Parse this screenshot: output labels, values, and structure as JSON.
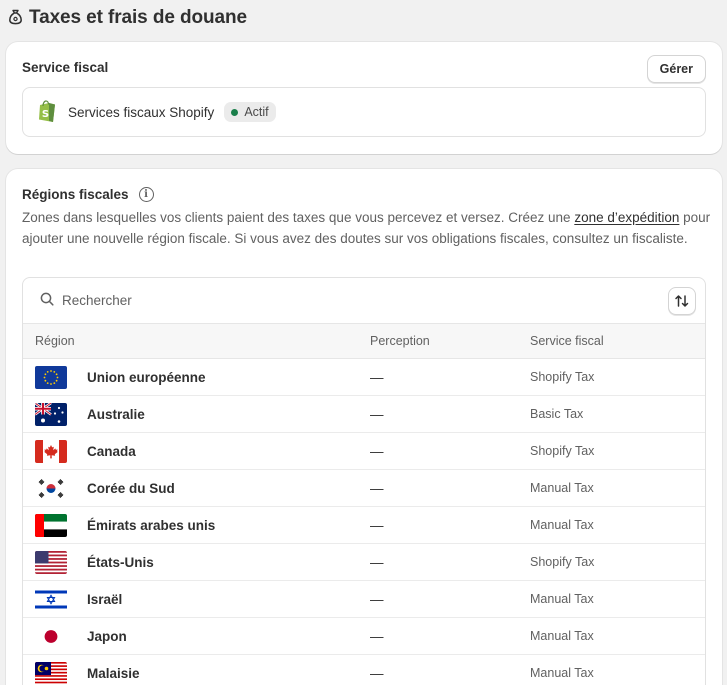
{
  "page": {
    "title": "Taxes et frais de douane",
    "title_icon": "money-bag-icon"
  },
  "service_card": {
    "heading": "Service fiscal",
    "manage_label": "Gérer",
    "service": {
      "name": "Services fiscaux Shopify",
      "status": "Actif",
      "status_color": "#1a7f4b",
      "icon": "shopify-bag-icon"
    }
  },
  "regions_card": {
    "heading": "Régions fiscales",
    "description_part1": "Zones dans lesquelles vos clients paient des taxes que vous percevez et versez. Créez une ",
    "description_link": "zone d’expédition",
    "description_part2": " pour ajouter une nouvelle région fiscale. Si vous avez des doutes sur vos obligations fiscales, consultez un fiscaliste.",
    "search_placeholder": "Rechercher",
    "columns": {
      "region": "Région",
      "perception": "Perception",
      "service": "Service fiscal"
    },
    "rows": [
      {
        "flag": "eu-flag",
        "region": "Union européenne",
        "perception": "—",
        "service": "Shopify Tax"
      },
      {
        "flag": "australia-flag",
        "region": "Australie",
        "perception": "—",
        "service": "Basic Tax"
      },
      {
        "flag": "canada-flag",
        "region": "Canada",
        "perception": "—",
        "service": "Shopify Tax"
      },
      {
        "flag": "south-korea-flag",
        "region": "Corée du Sud",
        "perception": "—",
        "service": "Manual Tax"
      },
      {
        "flag": "uae-flag",
        "region": "Émirats arabes unis",
        "perception": "—",
        "service": "Manual Tax"
      },
      {
        "flag": "usa-flag",
        "region": "États-Unis",
        "perception": "—",
        "service": "Shopify Tax"
      },
      {
        "flag": "israel-flag",
        "region": "Israël",
        "perception": "—",
        "service": "Manual Tax"
      },
      {
        "flag": "japan-flag",
        "region": "Japon",
        "perception": "—",
        "service": "Manual Tax"
      },
      {
        "flag": "malaysia-flag",
        "region": "Malaisie",
        "perception": "—",
        "service": "Manual Tax"
      }
    ]
  }
}
